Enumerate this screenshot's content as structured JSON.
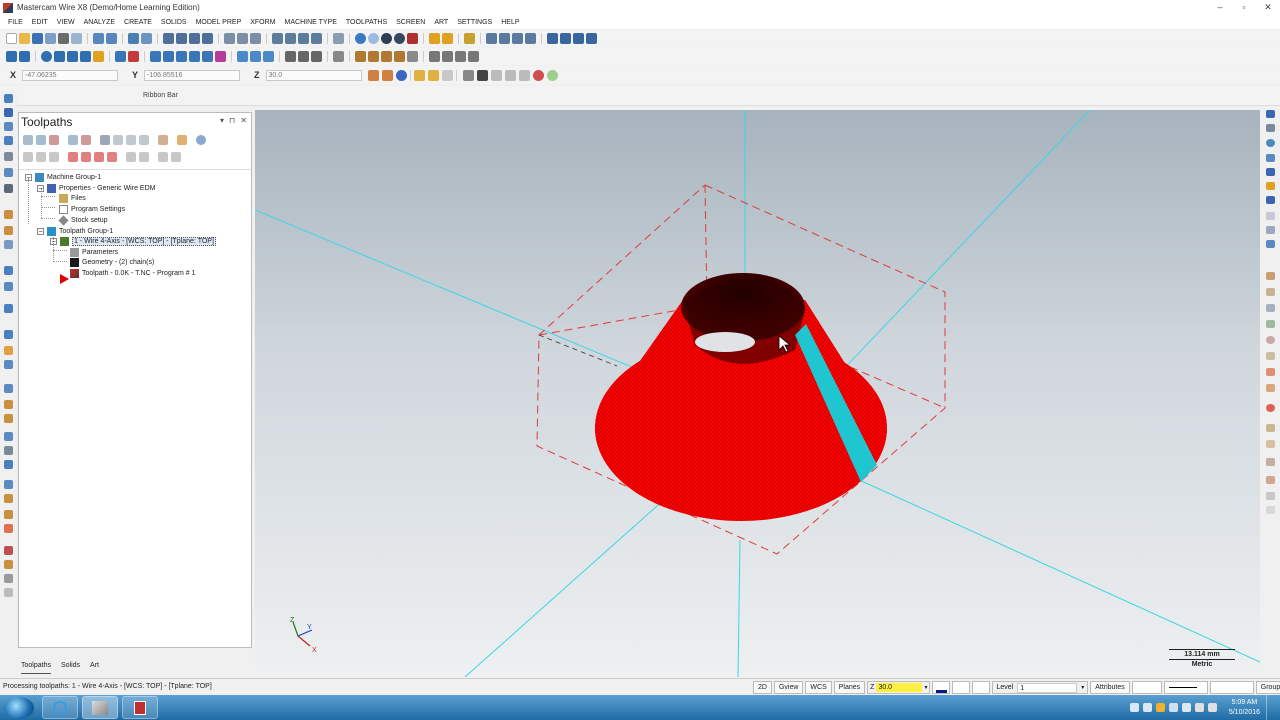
{
  "window": {
    "title": "Mastercam Wire X8 (Demo/Home Learning Edition)",
    "controls": [
      "–",
      "▫",
      "✕"
    ]
  },
  "menu": [
    "FILE",
    "EDIT",
    "VIEW",
    "ANALYZE",
    "CREATE",
    "SOLIDS",
    "MODEL PREP",
    "XFORM",
    "MACHINE TYPE",
    "TOOLPATHS",
    "SCREEN",
    "ART",
    "SETTINGS",
    "HELP"
  ],
  "coords": {
    "x_label": "X",
    "x_value": "-47.06235",
    "y_label": "Y",
    "y_value": "-106.85516",
    "z_label": "Z",
    "z_value": "30.0"
  },
  "ribbon": {
    "label": "Ribbon Bar"
  },
  "panel": {
    "title": "Toolpaths",
    "controls": [
      "▾",
      "⊓",
      "✕"
    ],
    "tree": [
      "Machine Group-1",
      "Properties - Generic Wire EDM",
      "Files",
      "Program Settings",
      "Stock setup",
      "Toolpath Group-1",
      "1 - Wire 4-Axis - [WCS: TOP] - [Tplane: TOP]",
      "Parameters",
      "Geometry - (2) chain(s)",
      "Toolpath - 0.0K - T.NC - Program # 1"
    ],
    "tabs": [
      "Toolpaths",
      "Solids",
      "Art"
    ]
  },
  "viewport": {
    "scale_value": "13.114 mm",
    "scale_unit": "Metric",
    "axis_labels": {
      "z": "Z",
      "y": "Y",
      "x": "X"
    },
    "colors": {
      "part": "#ff0000",
      "wire_path": "#1fc6cf",
      "axis_lines": "#3ad6e8",
      "stock_box": "#e03a3a"
    }
  },
  "status": {
    "text": "Processing toolpaths: 1 - Wire 4-Axis - [WCS: TOP] - [Tplane: TOP]",
    "mode_2d": "2D",
    "gview": "Gview",
    "wcs": "WCS",
    "planes": "Planes",
    "z_label": "Z",
    "z_value": "30.0",
    "level_label": "Level",
    "level_value": "1",
    "attributes": "Attributes",
    "groups": "Groups"
  },
  "taskbar": {
    "time": "5:09 AM",
    "date": "5/10/2016"
  }
}
